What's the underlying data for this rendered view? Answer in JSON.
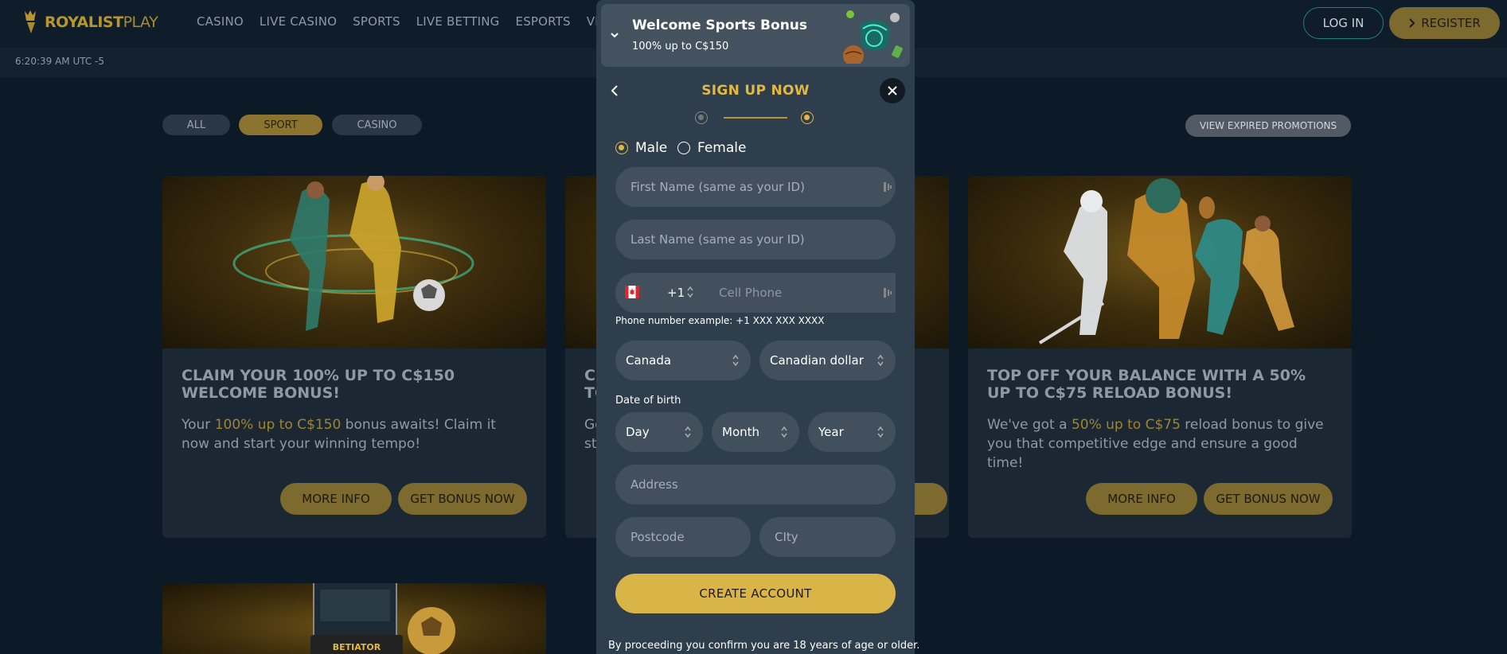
{
  "header": {
    "logo_bold": "ROYALIST",
    "logo_light": "PLAY",
    "nav": [
      "CASINO",
      "LIVE CASINO",
      "SPORTS",
      "LIVE BETTING",
      "ESPORTS",
      "VIRTU"
    ],
    "login_label": "LOG IN",
    "register_label": "REGISTER"
  },
  "clock": "6:20:39 AM UTC -5",
  "filters": {
    "all": "ALL",
    "sport": "SPORT",
    "casino": "CASINO",
    "active": "SPORT"
  },
  "expired_label": "VIEW EXPIRED PROMOTIONS",
  "cards": [
    {
      "title": "CLAIM YOUR 100% UP TO C$150 WELCOME BONUS!",
      "text_pre": "Your ",
      "text_hl": "100% up to C$150",
      "text_post": " bonus awaits! Claim it now and start your winning tempo!",
      "more_info": "MORE INFO",
      "get_bonus": "GET BONUS NOW"
    },
    {
      "title_partial": "CL TO",
      "text_partial": "Go st",
      "text_tail": "t"
    },
    {
      "title": "TOP OFF YOUR BALANCE WITH A 50% UP TO C$75 RELOAD BONUS!",
      "text_pre": "We've got a ",
      "text_hl": "50% up to C$75",
      "text_post": " reload bonus to give you that competitive edge and ensure a good time!",
      "more_info": "MORE INFO",
      "get_bonus": "GET BONUS NOW"
    }
  ],
  "modal": {
    "bonus_title": "Welcome Sports Bonus",
    "bonus_sub": "100% up to C$150",
    "signup_title": "SIGN UP NOW",
    "steps_total": 2,
    "steps_current": 2,
    "gender": {
      "male": "Male",
      "female": "Female",
      "selected": "Male"
    },
    "first_name_placeholder": "First Name (same as your ID)",
    "last_name_placeholder": "Last Name (same as your ID)",
    "phone_code": "+1",
    "phone_placeholder": "Cell Phone",
    "phone_hint": "Phone number example: +1 XXX XXX XXXX",
    "country": "Canada",
    "currency": "Canadian dollar",
    "dob_label": "Date of birth",
    "day": "Day",
    "month": "Month",
    "year": "Year",
    "address_placeholder": "Address",
    "postcode_placeholder": "Postcode",
    "city_placeholder": "CIty",
    "create_label": "CREATE ACCOUNT",
    "legal": "By proceeding you confirm you are 18 years of age or older."
  },
  "colors": {
    "gold": "#e2b844",
    "gold_dim": "#7d6a2e",
    "bg": "#0c1a27",
    "modal_bg": "#2f3e4d",
    "field_bg": "#42505e",
    "teal": "#1f7f7c"
  }
}
